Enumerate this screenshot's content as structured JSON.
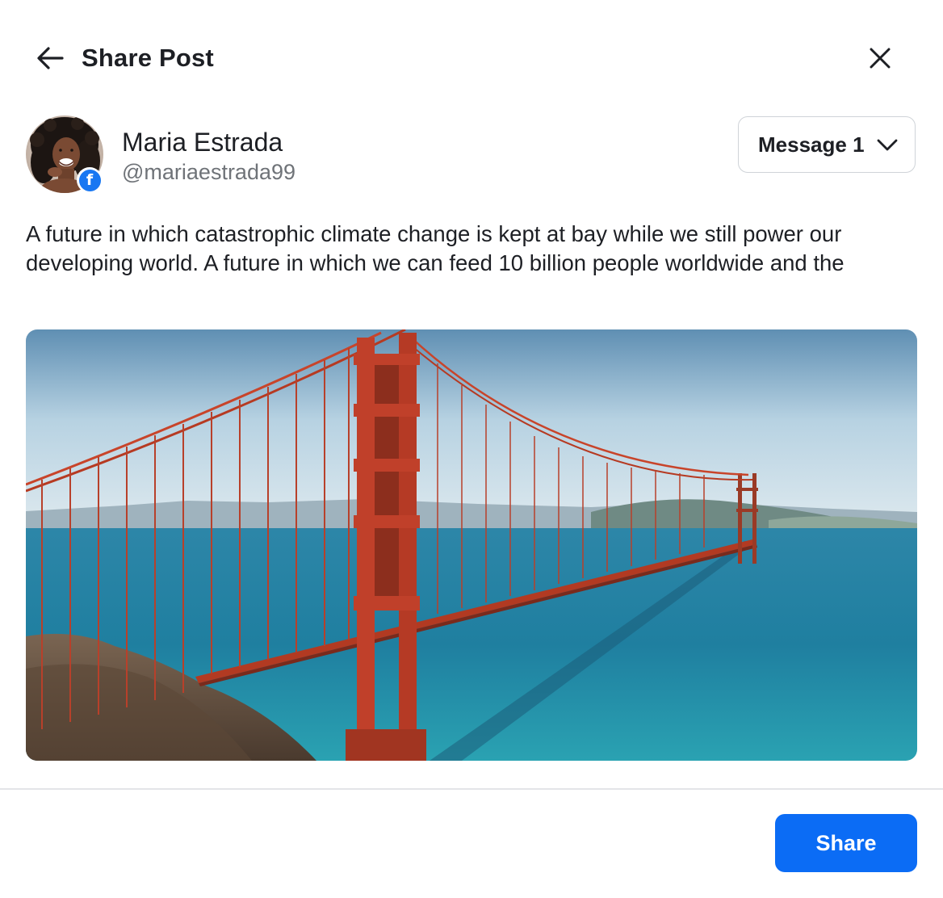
{
  "header": {
    "title": "Share Post",
    "back_icon": "arrow-left-icon",
    "close_icon": "close-icon"
  },
  "profile": {
    "name": "Maria Estrada",
    "handle": "@mariaestrada99",
    "network_icon": "facebook-icon",
    "network_badge_glyph": "f"
  },
  "message_select": {
    "selected": "Message 1",
    "icon": "chevron-down-icon"
  },
  "post": {
    "text": "A future in which catastrophic climate change is kept at bay while we still power our developing world. A future in which we can feed 10 billion people worldwide and the",
    "image_subject": "golden-gate-bridge-photo"
  },
  "footer": {
    "share_label": "Share"
  },
  "colors": {
    "primary": "#0b6cf5",
    "facebook": "#1877f2",
    "text": "#1d1f24",
    "muted": "#6f7378",
    "border": "#cfd3d8"
  }
}
